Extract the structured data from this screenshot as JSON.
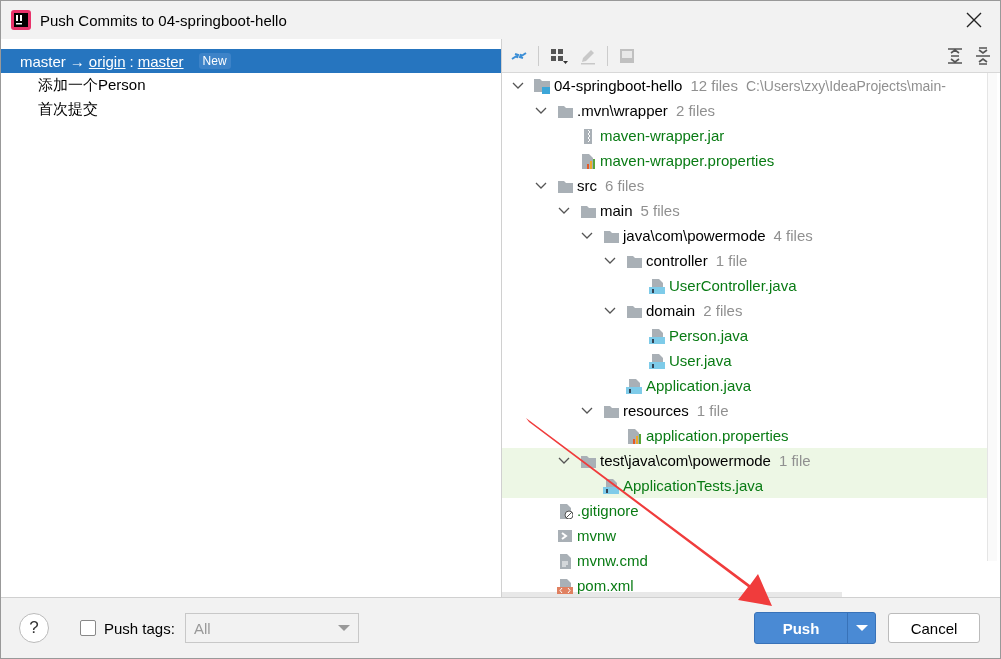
{
  "window": {
    "title": "Push Commits to 04-springboot-hello"
  },
  "commits_panel": {
    "branch": {
      "local": "master",
      "arrow": "→",
      "remote": "origin",
      "separator": ":",
      "remote_branch": "master",
      "badge": "New",
      "selected": true
    },
    "commits": [
      {
        "message": "添加一个Person",
        "selected": false
      },
      {
        "message": "首次提交",
        "selected": false
      }
    ]
  },
  "tree": {
    "nodes": [
      {
        "kind": "module",
        "name": "04-springboot-hello",
        "count": "12 files",
        "path": "C:\\Users\\zxy\\IdeaProjects\\main-",
        "expanded": true,
        "selected": false,
        "children": [
          {
            "kind": "folder",
            "name": ".mvn\\wrapper",
            "count": "2 files",
            "expanded": true,
            "selected": false,
            "children": [
              {
                "kind": "jar",
                "name": "maven-wrapper.jar",
                "selected": false
              },
              {
                "kind": "properties",
                "name": "maven-wrapper.properties",
                "selected": false
              }
            ]
          },
          {
            "kind": "folder",
            "name": "src",
            "count": "6 files",
            "expanded": true,
            "selected": false,
            "children": [
              {
                "kind": "folder",
                "name": "main",
                "count": "5 files",
                "expanded": true,
                "selected": false,
                "children": [
                  {
                    "kind": "folder",
                    "name": "java\\com\\powermode",
                    "count": "4 files",
                    "expanded": true,
                    "selected": false,
                    "children": [
                      {
                        "kind": "folder",
                        "name": "controller",
                        "count": "1 file",
                        "expanded": true,
                        "selected": false,
                        "children": [
                          {
                            "kind": "java",
                            "name": "UserController.java",
                            "selected": false
                          }
                        ]
                      },
                      {
                        "kind": "folder",
                        "name": "domain",
                        "count": "2 files",
                        "expanded": true,
                        "selected": false,
                        "children": [
                          {
                            "kind": "java",
                            "name": "Person.java",
                            "selected": false
                          },
                          {
                            "kind": "java",
                            "name": "User.java",
                            "selected": false
                          }
                        ]
                      },
                      {
                        "kind": "java",
                        "name": "Application.java",
                        "selected": false
                      }
                    ]
                  },
                  {
                    "kind": "folder",
                    "name": "resources",
                    "count": "1 file",
                    "expanded": true,
                    "selected": false,
                    "children": [
                      {
                        "kind": "properties",
                        "name": "application.properties",
                        "selected": false
                      }
                    ]
                  }
                ]
              },
              {
                "kind": "folder",
                "name": "test\\java\\com\\powermode",
                "count": "1 file",
                "expanded": true,
                "selected": true,
                "children": [
                  {
                    "kind": "java",
                    "name": "ApplicationTests.java",
                    "selected": true
                  }
                ]
              }
            ]
          },
          {
            "kind": "gitignore",
            "name": ".gitignore",
            "selected": false
          },
          {
            "kind": "script",
            "name": "mvnw",
            "selected": false
          },
          {
            "kind": "text",
            "name": "mvnw.cmd",
            "selected": false
          },
          {
            "kind": "xml",
            "name": "pom.xml",
            "selected": false
          }
        ]
      }
    ]
  },
  "bottom_bar": {
    "help": "?",
    "push_tags": {
      "label": "Push tags:",
      "checked": false
    },
    "tags_dropdown": {
      "value": "All",
      "disabled": true
    },
    "push_button": "Push",
    "cancel_button": "Cancel"
  }
}
